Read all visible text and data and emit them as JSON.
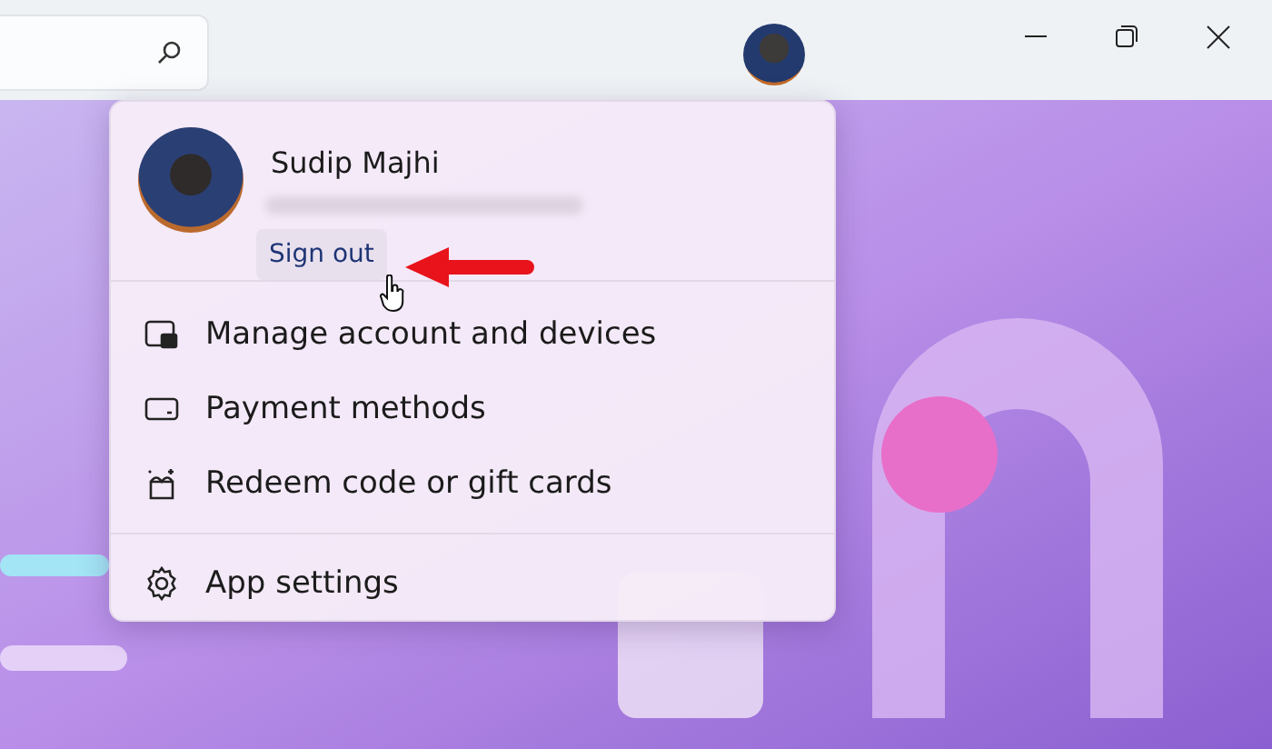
{
  "user": {
    "name": "Sudip Majhi",
    "sign_out": "Sign out"
  },
  "menu": {
    "groups": [
      [
        {
          "kind": "account",
          "label": "Manage account and devices"
        },
        {
          "kind": "payment",
          "label": "Payment methods"
        },
        {
          "kind": "redeem",
          "label": "Redeem code or gift cards"
        }
      ],
      [
        {
          "kind": "settings",
          "label": "App settings"
        }
      ]
    ]
  }
}
